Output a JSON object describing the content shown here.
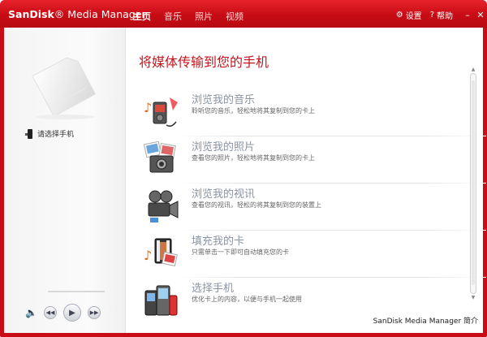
{
  "app": {
    "brand_bold": "SanDisk",
    "brand_rest": "® Media Manager"
  },
  "nav": [
    {
      "label": "主页",
      "active": true
    },
    {
      "label": "音乐",
      "active": false
    },
    {
      "label": "照片",
      "active": false
    },
    {
      "label": "视频",
      "active": false
    }
  ],
  "titlebar": {
    "settings_label": "设置",
    "help_label": "帮助",
    "minimize": "–",
    "close": "✕"
  },
  "left": {
    "phone_hint": "请选择手机"
  },
  "main": {
    "headline": "将媒体传输到您的手机",
    "items": [
      {
        "title": "浏览我的音乐",
        "desc": "聆听您的音乐，轻松地将其复制到您的卡上"
      },
      {
        "title": "浏览我的照片",
        "desc": "查看您的照片，轻松地将其复制到您的卡上"
      },
      {
        "title": "浏览我的视讯",
        "desc": "查看您的视讯，轻松的将其复制到您的装置上"
      },
      {
        "title": "填充我的卡",
        "desc": "只需单击一下即可自动填充您的卡"
      },
      {
        "title": "选择手机",
        "desc": "优化卡上的内容，以便与手机一起使用"
      }
    ]
  },
  "footer": {
    "about_label": "SanDisk Media Manager 简介"
  },
  "colors": {
    "brand_red": "#c80d16",
    "headline_red": "#c4141c",
    "item_title": "#8b94a3"
  }
}
